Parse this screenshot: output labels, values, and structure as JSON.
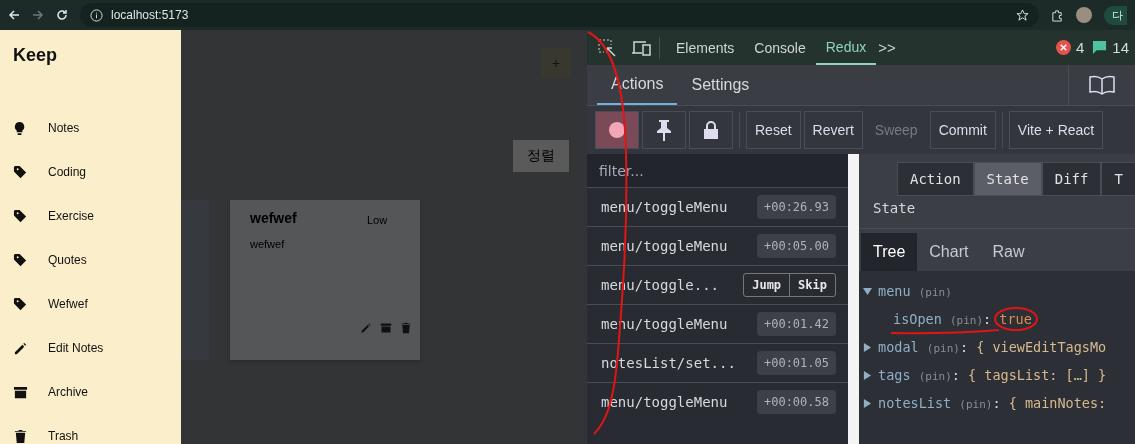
{
  "browser": {
    "url": "localhost:5173",
    "profile_label": "다"
  },
  "sidebar": {
    "title": "Keep",
    "items": [
      {
        "label": "Notes",
        "kind": "bulb"
      },
      {
        "label": "Coding",
        "kind": "tag"
      },
      {
        "label": "Exercise",
        "kind": "tag"
      },
      {
        "label": "Quotes",
        "kind": "tag"
      },
      {
        "label": "Wefwef",
        "kind": "tag"
      },
      {
        "label": "Edit Notes",
        "kind": "pencil"
      },
      {
        "label": "Archive",
        "kind": "archive"
      },
      {
        "label": "Trash",
        "kind": "trash"
      }
    ]
  },
  "notes_page": {
    "add_button": "+",
    "sort_button": "정렬",
    "note": {
      "title": "wefwef",
      "priority": "Low",
      "body": "wefwef"
    }
  },
  "devtools": {
    "tabs": [
      {
        "label": "Elements",
        "selected": false
      },
      {
        "label": "Console",
        "selected": false
      },
      {
        "label": "Redux",
        "selected": true
      }
    ],
    "more": ">>",
    "error_count": "4",
    "message_count": "14",
    "subtabs": [
      {
        "label": "Actions",
        "selected": true
      },
      {
        "label": "Settings",
        "selected": false
      }
    ],
    "toolbar": {
      "recording": true,
      "buttons": [
        {
          "label": "Reset",
          "disabled": false
        },
        {
          "label": "Revert",
          "disabled": false
        },
        {
          "label": "Sweep",
          "disabled": true
        },
        {
          "label": "Commit",
          "disabled": false
        }
      ],
      "instance": "Vite + React"
    },
    "filter": {
      "placeholder": "filter..."
    },
    "actions": [
      {
        "name": "menu/toggleMenu",
        "time": "+00:26.93",
        "kind": "time"
      },
      {
        "name": "menu/toggleMenu",
        "time": "+00:05.00",
        "kind": "time"
      },
      {
        "name": "menu/toggle...",
        "kind": "hover",
        "jump": "Jump",
        "skip": "Skip"
      },
      {
        "name": "menu/toggleMenu",
        "time": "+00:01.42",
        "kind": "time"
      },
      {
        "name": "notesList/set...",
        "time": "+00:01.05",
        "kind": "time"
      },
      {
        "name": "menu/toggleMenu",
        "time": "+00:00.58",
        "kind": "time"
      }
    ],
    "inspector_tabs": [
      {
        "label": "Action",
        "selected": false
      },
      {
        "label": "State",
        "selected": true
      },
      {
        "label": "Diff",
        "selected": false
      },
      {
        "label": "T",
        "selected": false
      }
    ],
    "inspector_title": "State",
    "view_tabs": [
      {
        "label": "Tree",
        "selected": true
      },
      {
        "label": "Chart",
        "selected": false
      },
      {
        "label": "Raw",
        "selected": false
      }
    ],
    "tree": [
      {
        "key": "menu",
        "pin": "(pin)",
        "expanded": true,
        "children": [
          {
            "key": "isOpen",
            "pin": "(pin)",
            "separator": ":",
            "value": "true"
          }
        ]
      },
      {
        "key": "modal",
        "pin": "(pin)",
        "expanded": false,
        "separator": ":",
        "summary": "{ viewEditTagsMo"
      },
      {
        "key": "tags",
        "pin": "(pin)",
        "expanded": false,
        "separator": ":",
        "summary": "{ tagsList: […] }"
      },
      {
        "key": "notesList",
        "pin": "(pin)",
        "expanded": false,
        "separator": ":",
        "summary": "{ mainNotes:"
      }
    ]
  }
}
